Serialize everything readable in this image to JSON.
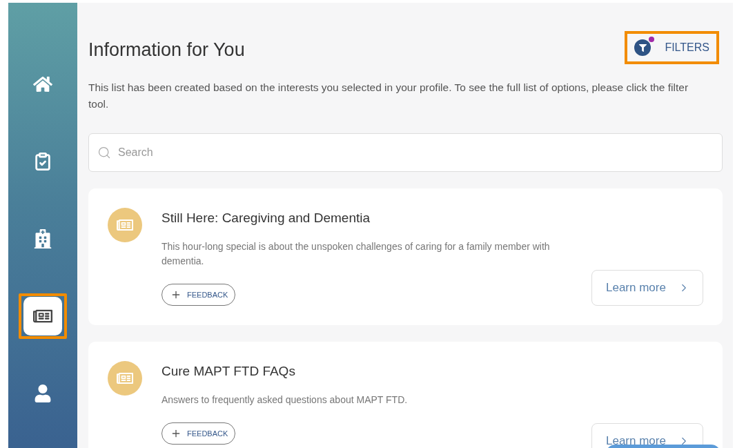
{
  "nav": {
    "items": [
      {
        "kind": "home",
        "selected": false,
        "highlighted": false
      },
      {
        "kind": "tasks",
        "selected": false,
        "highlighted": false
      },
      {
        "kind": "care",
        "selected": false,
        "highlighted": false
      },
      {
        "kind": "info",
        "selected": true,
        "highlighted": true
      },
      {
        "kind": "profile",
        "selected": false,
        "highlighted": false
      }
    ]
  },
  "header": {
    "title": "Information for You",
    "filters": {
      "label": "FILTERS",
      "active": true,
      "highlighted": true
    }
  },
  "description": "This list has been created based on the interests you selected in your profile. To see the full list of options, please click the filter tool.",
  "search": {
    "placeholder": "Search"
  },
  "cards": [
    {
      "title": "Still Here: Caregiving and Dementia",
      "text": "This hour-long special is about the unspoken challenges of caring for a family member with dementia.",
      "feedback": "FEEDBACK",
      "action": "Learn more"
    },
    {
      "title": "Cure MAPT FTD FAQs",
      "text": "Answers to frequently asked questions about MAPT FTD.",
      "feedback": "FEEDBACK",
      "action": "Learn more"
    }
  ]
}
